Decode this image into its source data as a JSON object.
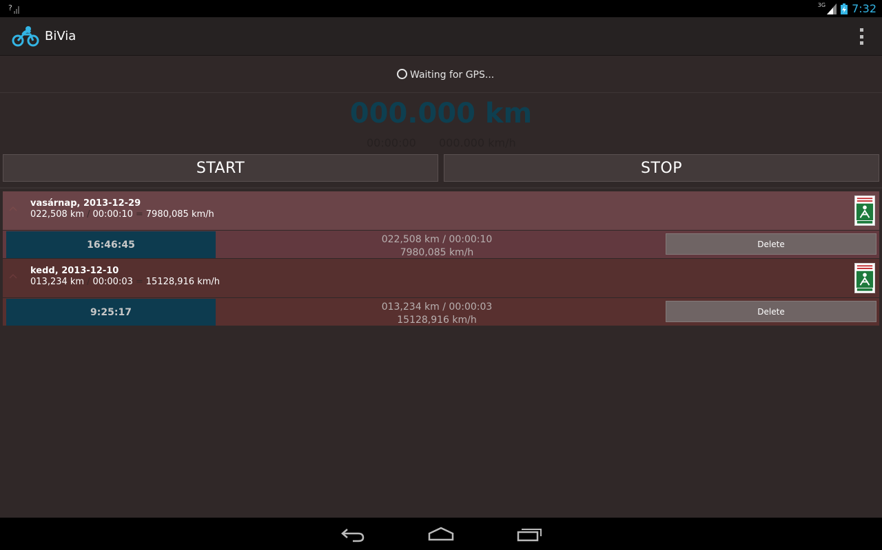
{
  "status_bar": {
    "signal_left": "?",
    "network": "3G",
    "time": "7:32"
  },
  "action_bar": {
    "title": "BiVia"
  },
  "gps": {
    "status_text": "Waiting for GPS..."
  },
  "tracker": {
    "distance": "000.000 km",
    "elapsed": "00:00:00",
    "speed": "000.000 km/h"
  },
  "buttons": {
    "start_label": "START",
    "stop_label": "STOP"
  },
  "trips": [
    {
      "date": "vasárnap, 2013-12-29",
      "distance": "022,508 km",
      "duration": "00:00:10",
      "speed": "7980,085 km/h",
      "sep1": "/",
      "sep2": "=",
      "start_time": "16:46:45",
      "detail_line1": "022,508 km /  00:00:10",
      "detail_line2": "7980,085 km/h",
      "delete_label": "Delete"
    },
    {
      "date": "kedd, 2013-12-10",
      "distance": "013,234 km",
      "duration": "00:00:03",
      "speed": "15128,916 km/h",
      "sep1": "/",
      "sep2": "=",
      "start_time": "9:25:17",
      "detail_line1": "013,234 km /  00:00:03",
      "detail_line2": "15128,916 km/h",
      "delete_label": "Delete"
    }
  ],
  "colors": {
    "accent": "#33b5e5",
    "distance": "#0e3f50",
    "time_block": "#0d3b4f"
  }
}
